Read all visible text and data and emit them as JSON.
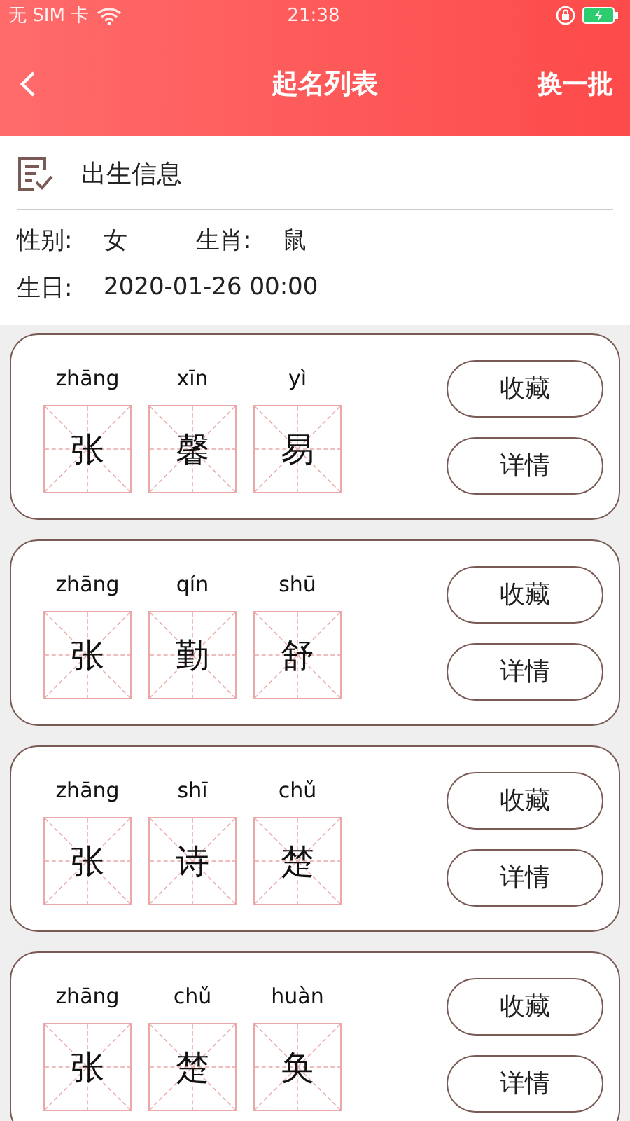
{
  "status_bar": {
    "carrier": "无 SIM 卡",
    "time": "21:38"
  },
  "header": {
    "title": "起名列表",
    "action": "换一批"
  },
  "birth_info": {
    "title": "出生信息",
    "fields": [
      {
        "label": "性别:",
        "value": "女"
      },
      {
        "label": "生肖:",
        "value": "鼠"
      },
      {
        "label": "生日:",
        "value": "2020-01-26 00:00"
      }
    ]
  },
  "names": [
    {
      "chars": [
        {
          "pinyin": "zhāng",
          "hanzi": "张"
        },
        {
          "pinyin": "xīn",
          "hanzi": "馨"
        },
        {
          "pinyin": "yì",
          "hanzi": "易"
        }
      ],
      "buttons": [
        "收藏",
        "详情"
      ]
    },
    {
      "chars": [
        {
          "pinyin": "zhāng",
          "hanzi": "张"
        },
        {
          "pinyin": "qín",
          "hanzi": "勤"
        },
        {
          "pinyin": "shū",
          "hanzi": "舒"
        }
      ],
      "buttons": [
        "收藏",
        "详情"
      ]
    },
    {
      "chars": [
        {
          "pinyin": "zhāng",
          "hanzi": "张"
        },
        {
          "pinyin": "shī",
          "hanzi": "诗"
        },
        {
          "pinyin": "chǔ",
          "hanzi": "楚"
        }
      ],
      "buttons": [
        "收藏",
        "详情"
      ]
    },
    {
      "chars": [
        {
          "pinyin": "zhāng",
          "hanzi": "张"
        },
        {
          "pinyin": "chǔ",
          "hanzi": "楚"
        },
        {
          "pinyin": "huàn",
          "hanzi": "奂"
        }
      ],
      "buttons": [
        "收藏",
        "详情"
      ]
    }
  ]
}
